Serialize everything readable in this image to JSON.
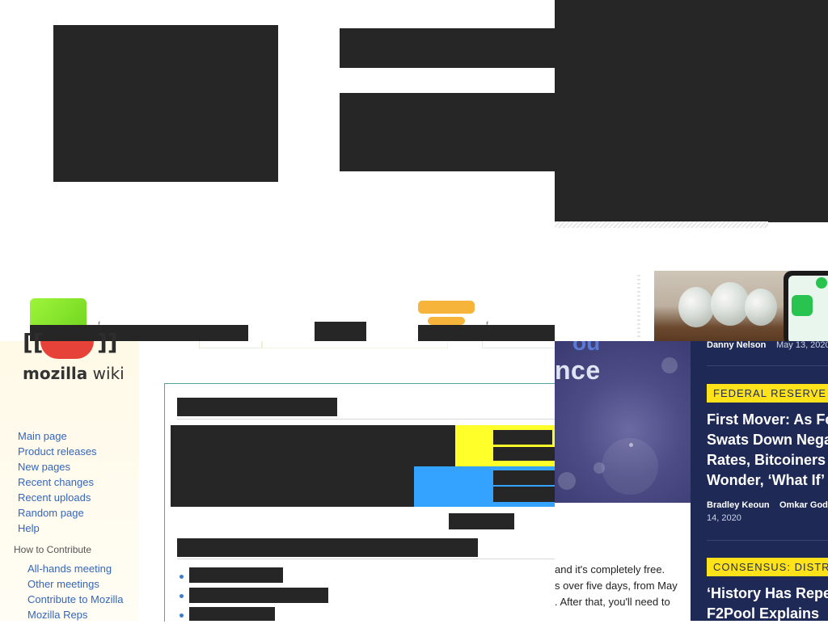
{
  "top_fragment": {
    "small_caption_1": "f",
    "small_caption_2": "f"
  },
  "wiki": {
    "logo_text_bold": "mozilla",
    "logo_text_light": " wiki",
    "nav": [
      "Main page",
      "Product releases",
      "New pages",
      "Recent changes",
      "Recent uploads",
      "Random page",
      "Help"
    ],
    "contribute_heading": "How to Contribute",
    "contribute_links": [
      "All-hands meeting",
      "Other meetings",
      "Contribute to Mozilla",
      "Mozilla Reps"
    ]
  },
  "coindesk": {
    "image_overlay_text": "nce",
    "image_top_text": "ou",
    "body_lines": [
      "and it's completely free.",
      "s over five days, from May",
      ". After that, you'll need to"
    ],
    "article1": {
      "author": "Danny Nelson",
      "date": "May 13, 2020"
    },
    "article2": {
      "tag": "FEDERAL RESERVE",
      "headline": [
        "First Mover: As Fe",
        "Swats Down Nega",
        "Rates, Bitcoiners",
        "Wonder, ‘What If’"
      ],
      "author1": "Bradley Keoun",
      "author2": "Omkar God",
      "date": "14, 2020"
    },
    "article3": {
      "tag": "CONSENSUS: DISTRI",
      "headline": [
        "‘History Has Repe",
        "F2Pool Explains"
      ]
    }
  }
}
